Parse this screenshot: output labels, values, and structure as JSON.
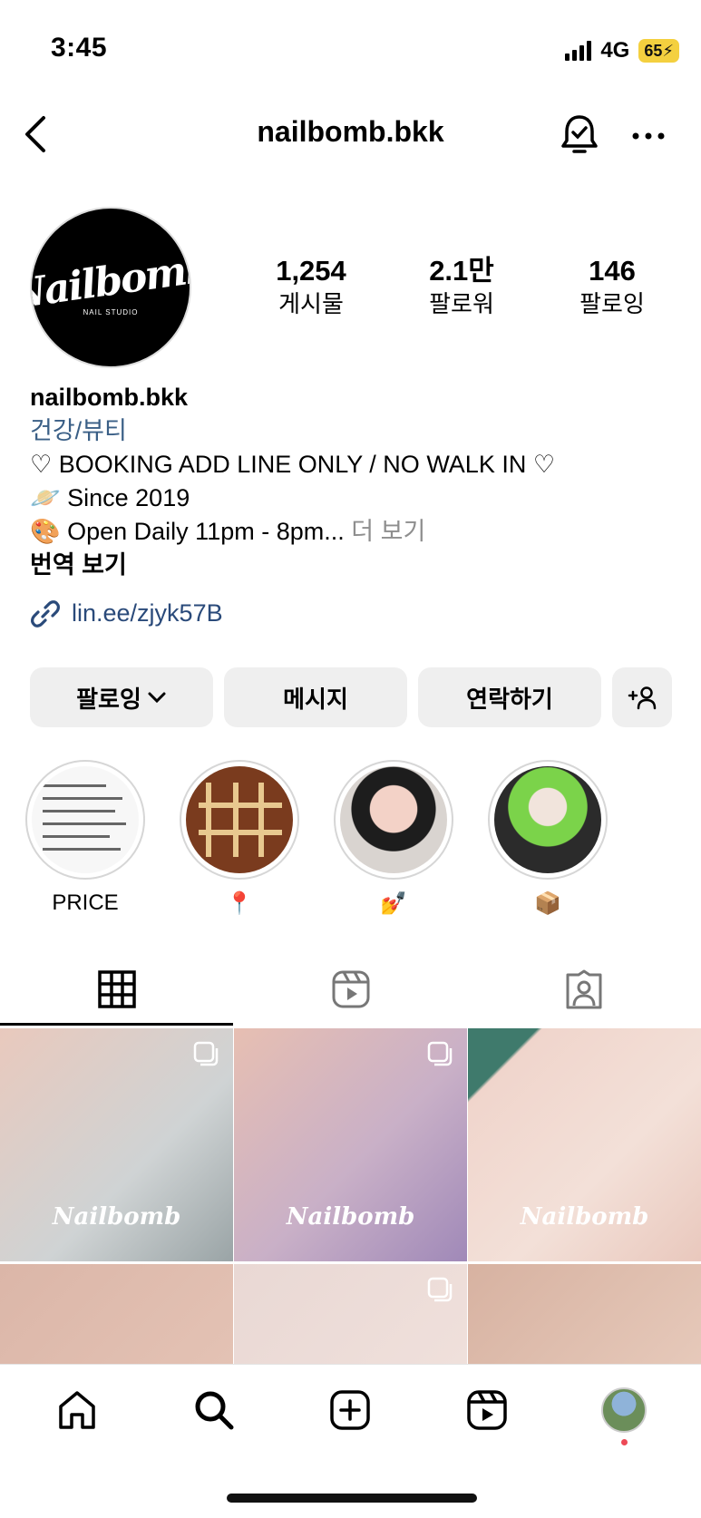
{
  "status_bar": {
    "time": "3:45",
    "network": "4G",
    "battery": "65"
  },
  "header": {
    "username": "nailbomb.bkk"
  },
  "profile": {
    "avatar_logo": "Nailbomb",
    "avatar_sub": "NAIL STUDIO",
    "stats": [
      {
        "value": "1,254",
        "label": "게시물"
      },
      {
        "value": "2.1만",
        "label": "팔로워"
      },
      {
        "value": "146",
        "label": "팔로잉"
      }
    ]
  },
  "bio": {
    "name": "nailbomb.bkk",
    "category": "건강/뷰티",
    "line1": "♡ BOOKING ADD LINE ONLY / NO WALK IN ♡",
    "line2": "🪐 Since 2019",
    "line3": "🎨 Open Daily 11pm - 8pm...",
    "more": "더 보기",
    "translate": "번역 보기",
    "link": "lin.ee/zjyk57B"
  },
  "actions": {
    "following": "팔로잉",
    "message": "메시지",
    "contact": "연락하기"
  },
  "highlights": [
    {
      "label": "PRICE"
    },
    {
      "label": "📍"
    },
    {
      "label": "💅"
    },
    {
      "label": "📦"
    }
  ],
  "grid": {
    "watermark": "Nailbomb"
  }
}
